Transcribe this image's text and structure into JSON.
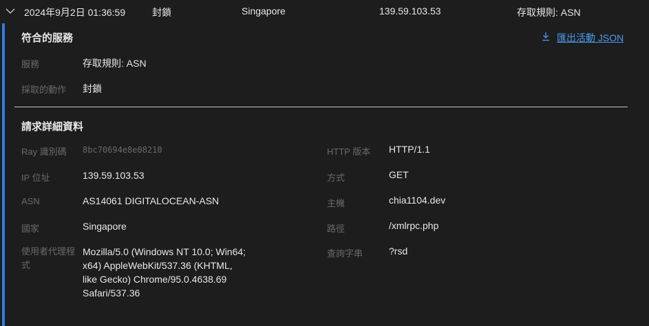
{
  "event_row": {
    "timestamp": "2024年9月2日 01:36:59",
    "action": "封鎖",
    "country": "Singapore",
    "ip": "139.59.103.53",
    "service": "存取規則: ASN",
    "chevron_icon": "chevron-down-icon"
  },
  "matched_service": {
    "title": "符合的服務",
    "export_label": "匯出活動 JSON",
    "export_icon": "download-icon",
    "fields": {
      "service_label": "服務",
      "service_value": "存取規則: ASN",
      "action_label": "採取的動作",
      "action_value": "封鎖"
    }
  },
  "request_details": {
    "title": "請求詳細資料",
    "left": {
      "ray_label": "Ray 識別碼",
      "ray_value": "8bc70694e8e08210",
      "ip_label": "IP 位址",
      "ip_value": "139.59.103.53",
      "asn_label": "ASN",
      "asn_value": "AS14061 DIGITALOCEAN-ASN",
      "country_label": "國家",
      "country_value": "Singapore",
      "ua_label": "使用者代理程式",
      "ua_value": "Mozilla/5.0 (Windows NT 10.0; Win64; x64) AppleWebKit/537.36 (KHTML, like Gecko) Chrome/95.0.4638.69 Safari/537.36"
    },
    "right": {
      "http_label": "HTTP 版本",
      "http_value": "HTTP/1.1",
      "method_label": "方式",
      "method_value": "GET",
      "host_label": "主機",
      "host_value": "chia1104.dev",
      "path_label": "路徑",
      "path_value": "/xmlrpc.php",
      "query_label": "查詢字串",
      "query_value": "?rsd"
    }
  },
  "colors": {
    "background": "#1d1d1d",
    "accent": "#2f7fe0",
    "link": "#4c9bf0",
    "label": "#6a6a6a",
    "text": "#e8e8e8"
  }
}
